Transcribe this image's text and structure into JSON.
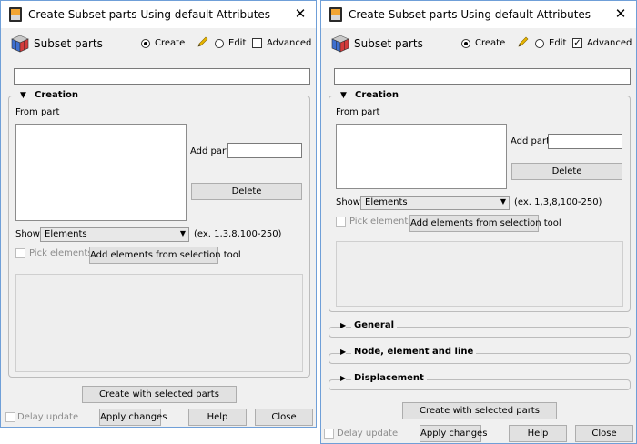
{
  "left": {
    "title": "Create Subset parts Using default Attributes",
    "header_title": "Subset parts",
    "mode_create": "Create",
    "mode_edit": "Edit",
    "advanced_label": "Advanced",
    "advanced_checked": false,
    "creation_label": "Creation",
    "from_part_label": "From part",
    "add_part_label": "Add part",
    "delete_label": "Delete",
    "show_label": "Show",
    "show_value": "Elements",
    "example_text": "(ex. 1,3,8,100-250)",
    "pick_elements_label": "Pick elements",
    "add_from_selection_label": "Add elements from selection tool",
    "create_selected_label": "Create with selected parts",
    "delay_update_label": "Delay update",
    "apply_label": "Apply changes",
    "help_label": "Help",
    "close_label": "Close"
  },
  "right": {
    "title": "Create Subset parts Using default Attributes",
    "header_title": "Subset parts",
    "mode_create": "Create",
    "mode_edit": "Edit",
    "advanced_label": "Advanced",
    "advanced_checked": true,
    "creation_label": "Creation",
    "from_part_label": "From part",
    "add_part_label": "Add part",
    "delete_label": "Delete",
    "show_label": "Show",
    "show_value": "Elements",
    "example_text": "(ex. 1,3,8,100-250)",
    "pick_elements_label": "Pick elements",
    "add_from_selection_label": "Add elements from selection tool",
    "general_label": "General",
    "node_element_line_label": "Node, element and line",
    "displacement_label": "Displacement",
    "create_selected_label": "Create with selected parts",
    "delay_update_label": "Delay update",
    "apply_label": "Apply changes",
    "help_label": "Help",
    "close_label": "Close"
  },
  "icons": {
    "app": "app-logo-icon",
    "header": "cube-icon",
    "close": "close-icon",
    "edit": "pencil-icon",
    "expand": "triangle-down-icon",
    "collapse": "triangle-right-icon",
    "dropdown": "chevron-down-icon"
  },
  "colors": {
    "window_border": "#6f9fd8",
    "dialog_bg": "#f0f0f0",
    "pencil": "#e8b500"
  }
}
